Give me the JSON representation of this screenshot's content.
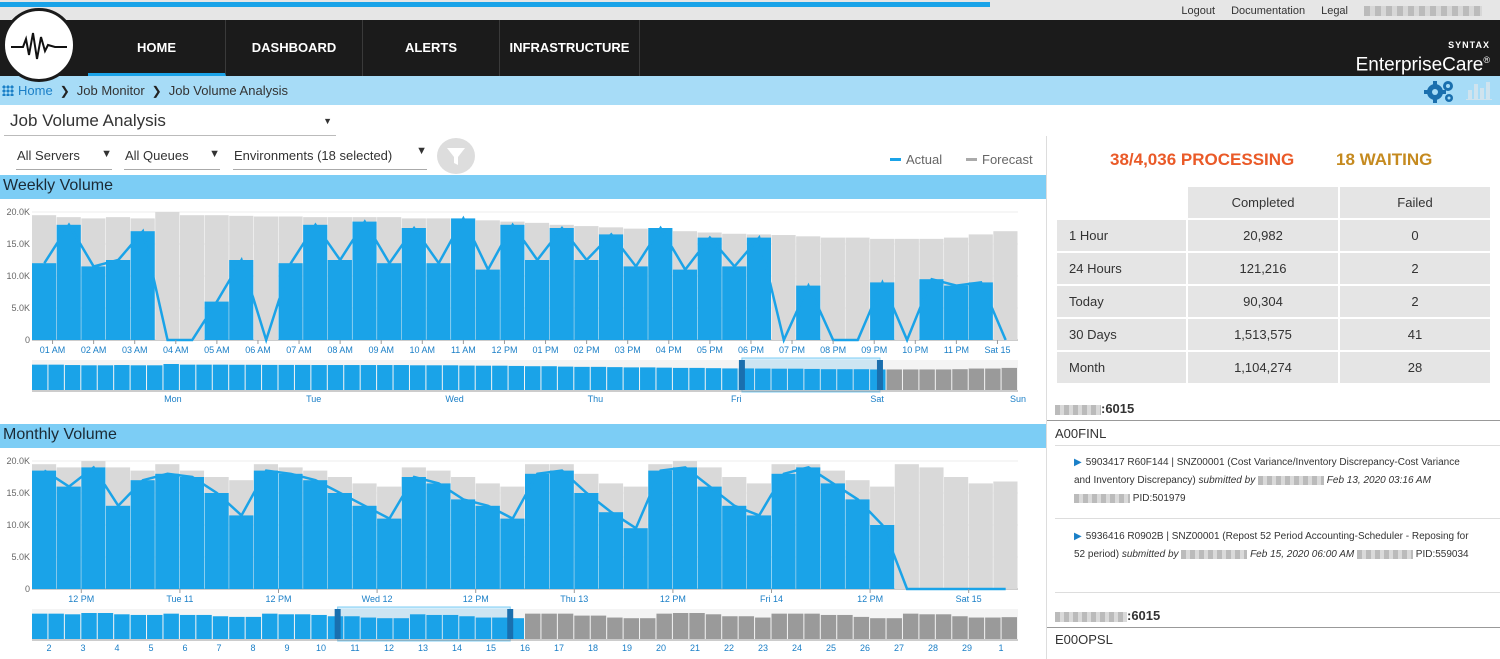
{
  "top_links": {
    "logout": "Logout",
    "documentation": "Documentation",
    "legal": "Legal"
  },
  "page_load_progress": 0.66,
  "nav": [
    {
      "label": "HOME",
      "active": true
    },
    {
      "label": "DASHBOARD",
      "active": false
    },
    {
      "label": "ALERTS",
      "active": false
    },
    {
      "label": "INFRASTRUCTURE",
      "active": false
    }
  ],
  "brand": {
    "line1": "SYNTAX",
    "line2": "EnterpriseCare",
    "mark": "®"
  },
  "breadcrumb": {
    "home": "Home",
    "item1": "Job Monitor",
    "item2": "Job Volume Analysis"
  },
  "page_select": {
    "value": "Job Volume Analysis"
  },
  "filters": {
    "servers": "All Servers",
    "queues": "All Queues",
    "environments": "Environments (18 selected)"
  },
  "legend": {
    "actual": "Actual",
    "forecast": "Forecast"
  },
  "colors": {
    "actual": "#1aa3e8",
    "forecast": "#d9d9d9",
    "processing": "#ea5a28",
    "waiting": "#c58a1f"
  },
  "icons": {
    "logo": "heartbeat-logo-icon",
    "grid": "grid-icon",
    "gear": "gears-icon",
    "bar": "bar-chart-icon",
    "filter": "filter-icon",
    "play": "play-icon"
  },
  "status": {
    "processing": "38/4,036 PROCESSING",
    "waiting": "18 WAITING"
  },
  "summary": {
    "headers": [
      "Completed",
      "Failed"
    ],
    "rows": [
      {
        "label": "1 Hour",
        "completed": "20,982",
        "failed": "0"
      },
      {
        "label": "24 Hours",
        "completed": "121,216",
        "failed": "2"
      },
      {
        "label": "Today",
        "completed": "90,304",
        "failed": "2"
      },
      {
        "label": "30 Days",
        "completed": "1,513,575",
        "failed": "41"
      },
      {
        "label": "Month",
        "completed": "1,104,274",
        "failed": "28"
      }
    ]
  },
  "environments": [
    {
      "port": ":6015",
      "name": "A00FINL",
      "jobs": [
        {
          "job_no": "5903417",
          "report": "R60F144",
          "text": "| SNZ00001 (Cost Variance/Inventory Discrepancy-Cost Variance and Inventory Discrepancy)",
          "submitted_by": "submitted by",
          "date": "Feb 13, 2020 03:16 AM",
          "pid": "PID:501979"
        },
        {
          "job_no": "5936416",
          "report": "R0902B",
          "text": "| SNZ00001 (Repost 52 Period Accounting-Scheduler - Reposing for 52 period)",
          "submitted_by": "submitted by",
          "date": "Feb 15, 2020 06:00 AM",
          "pid": "PID:559034"
        }
      ]
    },
    {
      "port": ":6015",
      "name": "E00OPSL",
      "jobs": []
    }
  ],
  "chart_data": [
    {
      "type": "area",
      "title": "Weekly Volume",
      "ylim": [
        0,
        20000
      ],
      "yticks": [
        "0",
        "5.0K",
        "10.0K",
        "15.0K",
        "20.0K"
      ],
      "x_ticks": [
        "01 AM",
        "02 AM",
        "03 AM",
        "04 AM",
        "05 AM",
        "06 AM",
        "07 AM",
        "08 AM",
        "09 AM",
        "10 AM",
        "11 AM",
        "12 PM",
        "01 PM",
        "02 PM",
        "03 PM",
        "04 PM",
        "05 PM",
        "06 PM",
        "07 PM",
        "08 PM",
        "09 PM",
        "10 PM",
        "11 PM",
        "Sat 15"
      ],
      "series": [
        {
          "name": "Actual",
          "values": [
            12000,
            18000,
            11500,
            12500,
            17000,
            0,
            0,
            6000,
            12500,
            0,
            12000,
            18000,
            12500,
            18500,
            12000,
            17500,
            12000,
            19000,
            11000,
            18000,
            12500,
            17500,
            12500,
            16500,
            11500,
            17500,
            11000,
            16000,
            11500,
            16000,
            0,
            8500,
            0,
            0,
            9000,
            0,
            9500,
            8500,
            9000,
            0
          ]
        },
        {
          "name": "Forecast",
          "values": [
            19500,
            19200,
            19000,
            19200,
            19000,
            20000,
            19500,
            19500,
            19400,
            19300,
            19300,
            19200,
            19200,
            19200,
            19200,
            19000,
            19000,
            18800,
            18700,
            18500,
            18300,
            18000,
            17800,
            17600,
            17400,
            17200,
            17000,
            16800,
            16600,
            16500,
            16400,
            16200,
            16000,
            16000,
            15800,
            15800,
            15800,
            16000,
            16500,
            17000
          ]
        }
      ],
      "navigator_ticks": [
        "Mon",
        "Tue",
        "Wed",
        "Thu",
        "Fri",
        "Sat",
        "Sun"
      ]
    },
    {
      "type": "area",
      "title": "Monthly Volume",
      "ylim": [
        0,
        20000
      ],
      "yticks": [
        "0",
        "5.0K",
        "10.0K",
        "15.0K",
        "20.0K"
      ],
      "x_ticks": [
        "12 PM",
        "Tue 11",
        "12 PM",
        "Wed 12",
        "12 PM",
        "Thu 13",
        "12 PM",
        "Fri 14",
        "12 PM",
        "Sat 15"
      ],
      "series": [
        {
          "name": "Actual",
          "values": [
            18500,
            16000,
            19000,
            13000,
            17000,
            18000,
            17500,
            15000,
            11500,
            18500,
            18000,
            17000,
            15000,
            13000,
            11000,
            17500,
            16500,
            14000,
            13000,
            11000,
            18000,
            18500,
            15000,
            12000,
            9500,
            18500,
            19000,
            16000,
            13000,
            11500,
            18000,
            19000,
            16500,
            14000,
            10000,
            0,
            0,
            0,
            0,
            0
          ]
        },
        {
          "name": "Forecast",
          "values": [
            19500,
            19000,
            20000,
            19000,
            18500,
            19500,
            18500,
            17500,
            17000,
            19500,
            19000,
            18500,
            17500,
            16500,
            16000,
            19000,
            18500,
            17500,
            16500,
            16000,
            19500,
            19500,
            18000,
            16500,
            16000,
            19500,
            20000,
            19000,
            17500,
            16500,
            19500,
            19500,
            18500,
            17000,
            16000,
            19500,
            19000,
            17500,
            16500,
            16800
          ]
        }
      ],
      "navigator_ticks": [
        "2",
        "3",
        "4",
        "5",
        "6",
        "7",
        "8",
        "9",
        "10",
        "11",
        "12",
        "13",
        "14",
        "15",
        "16",
        "17",
        "18",
        "19",
        "20",
        "21",
        "22",
        "23",
        "24",
        "25",
        "26",
        "27",
        "28",
        "29",
        "1"
      ]
    }
  ]
}
